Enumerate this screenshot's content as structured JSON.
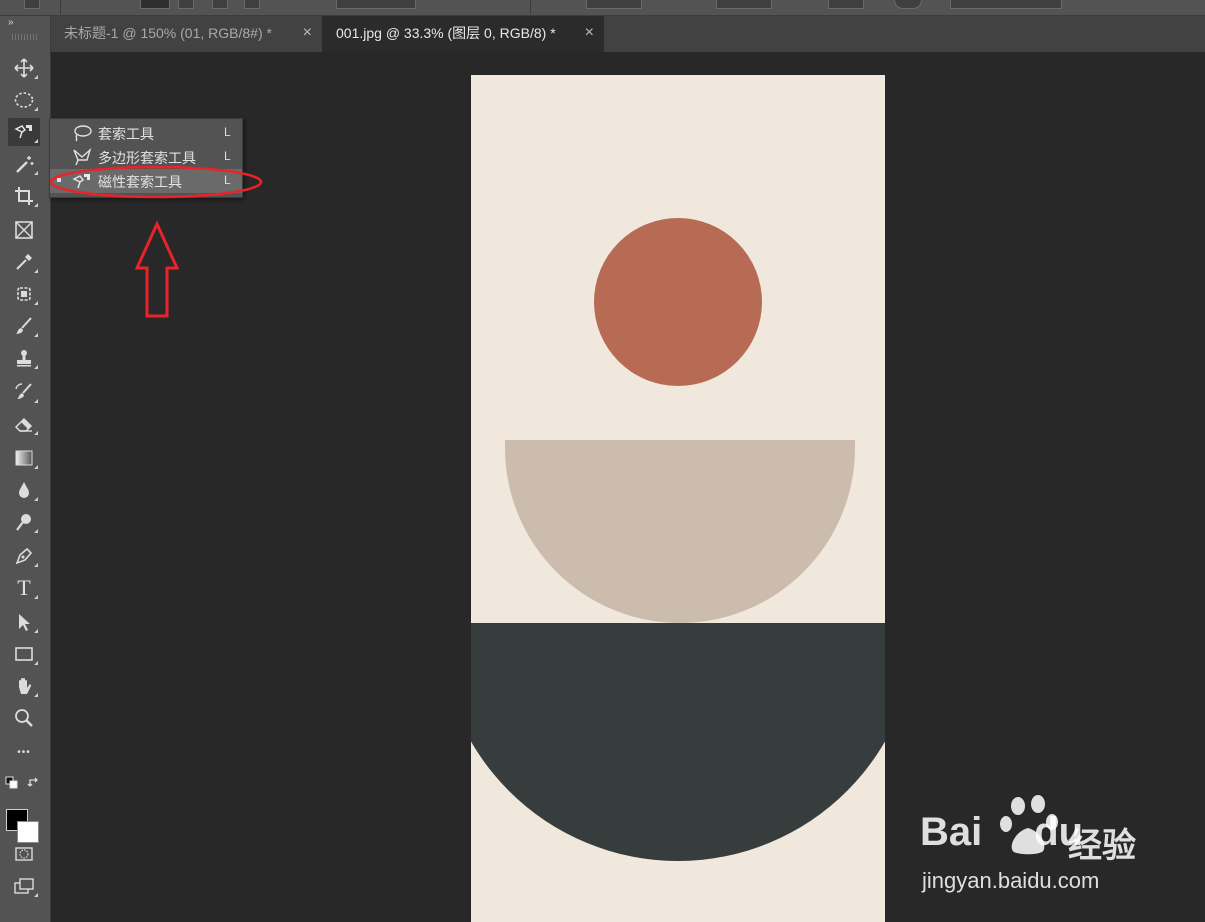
{
  "tabs": [
    {
      "label": "未标题-1 @ 150% (01, RGB/8#) *",
      "close": "×"
    },
    {
      "label": "001.jpg @ 33.3% (图层 0, RGB/8) *",
      "close": "×"
    }
  ],
  "toolbar": {
    "collapse": "»"
  },
  "flyout": {
    "items": [
      {
        "label": "套索工具",
        "key": "L"
      },
      {
        "label": "多边形套索工具",
        "key": "L"
      },
      {
        "label": "磁性套索工具",
        "key": "L"
      }
    ]
  },
  "tools": [
    "move-icon",
    "marquee-icon",
    "magnetic-lasso-icon",
    "magic-wand-icon",
    "crop-icon",
    "frame-icon",
    "eyedropper-icon",
    "patch-icon",
    "brush-icon",
    "stamp-icon",
    "history-brush-icon",
    "eraser-icon",
    "gradient-icon",
    "blur-icon",
    "dodge-icon",
    "pen-icon",
    "type-icon",
    "path-select-icon",
    "rectangle-icon",
    "hand-icon",
    "zoom-icon",
    "more-icon"
  ],
  "tools_type_glyph": "T",
  "tools_more_glyph": "•••",
  "colors": {
    "foreground": "#000000",
    "background": "#ffffff",
    "annotation": "#e8232a"
  },
  "watermark": {
    "logo": "Bai",
    "logo2": "du",
    "cn": "经验",
    "url": "jingyan.baidu.com"
  }
}
